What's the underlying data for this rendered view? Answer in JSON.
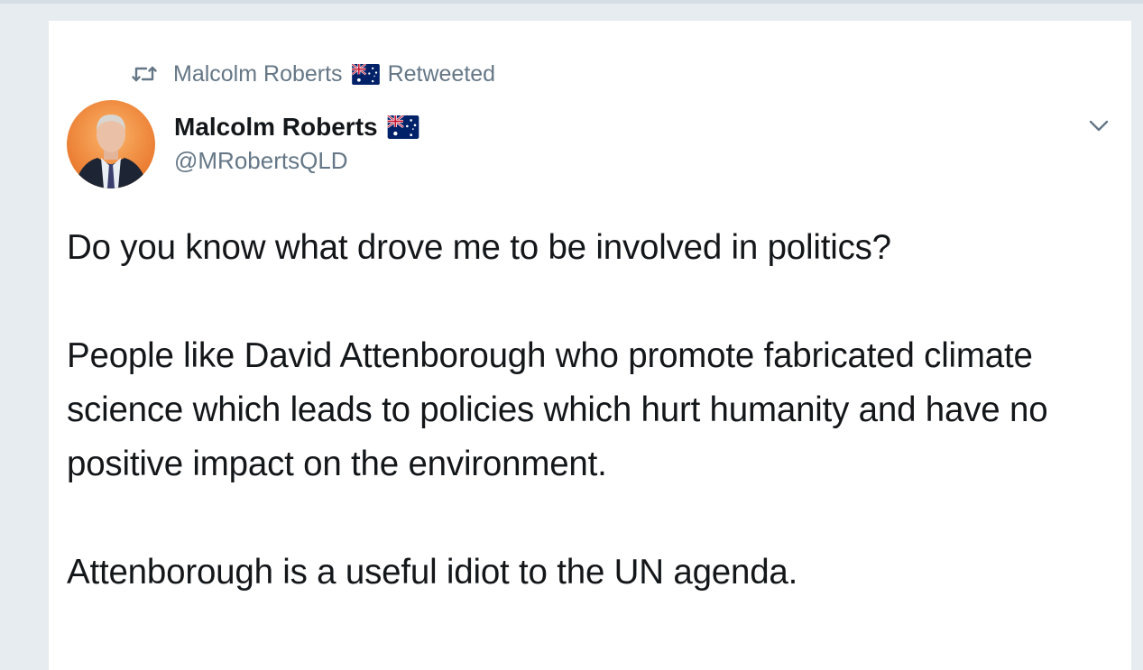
{
  "retweet": {
    "icon": "retweet-icon",
    "user_name": "Malcolm Roberts",
    "action": "Retweeted"
  },
  "author": {
    "name": "Malcolm Roberts",
    "handle": "@MRobertsQLD",
    "flag_icon": "australia-flag-icon",
    "avatar_bg": "#f08a3c"
  },
  "menu": {
    "icon": "chevron-down-icon"
  },
  "tweet": {
    "paragraphs": [
      "Do you know what drove me to be involved in politics?",
      "People like David Attenborough who promote fabricated climate science which leads to policies which hurt humanity and have no positive impact on the environment.",
      "Attenborough is a useful idiot to the UN agenda."
    ]
  },
  "colors": {
    "background": "#e6ecf0",
    "card": "#ffffff",
    "text": "#14171a",
    "secondary": "#657786"
  }
}
